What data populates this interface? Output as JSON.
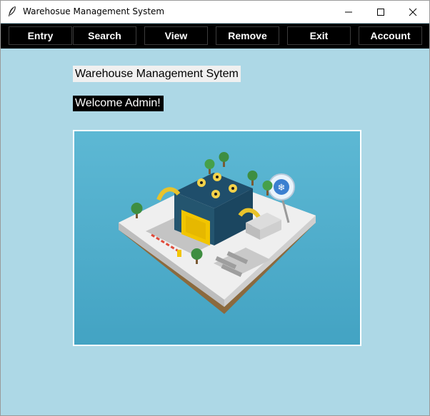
{
  "window": {
    "title": "Warehosue Management System",
    "icon": "feather-icon",
    "controls": [
      "minimize-icon",
      "maximize-icon",
      "close-icon"
    ]
  },
  "nav": {
    "entry": "Entry",
    "search": "Search",
    "view": "View",
    "remove": "Remove",
    "exit": "Exit",
    "account": "Account"
  },
  "main": {
    "heading": "Warehouse Management Sytem",
    "welcome": "Welcome Admin!",
    "image": "isometric-warehouse-illustration"
  },
  "colors": {
    "background": "#add8e6",
    "navbar": "#000000",
    "nav_text": "#ffffff",
    "heading_bg": "#f0f0f0",
    "welcome_bg": "#000000"
  }
}
